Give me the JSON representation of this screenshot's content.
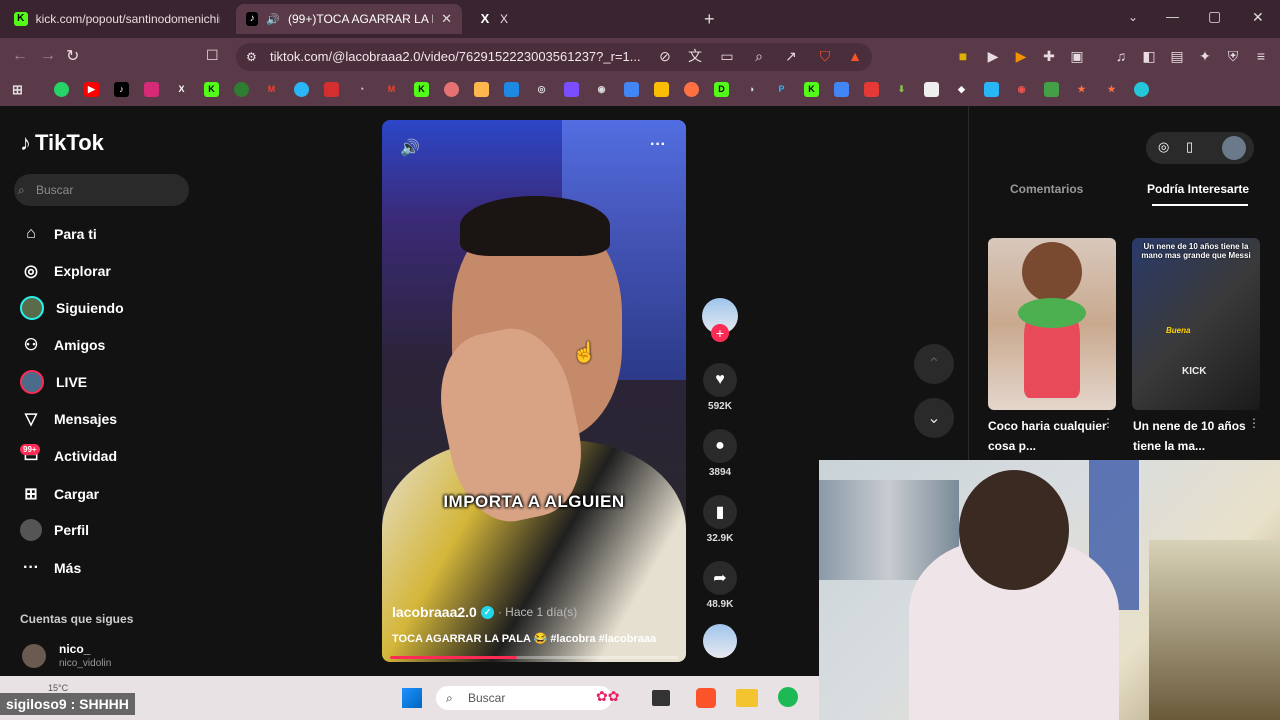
{
  "browser": {
    "tabs": [
      {
        "title": "kick.com/popout/santinodomenichin",
        "favicon": "K",
        "color": "#53fc18"
      },
      {
        "title": "(99+)TOCA AGARRAR LA PAL",
        "favicon": "♪",
        "color": "#000000"
      },
      {
        "title": "X",
        "favicon": "X",
        "color": "#000000"
      }
    ],
    "new_tab": "+",
    "url": "tiktok.com/@lacobraaa2.0/video/7629152223003561237?_r=1...",
    "window_controls": [
      "—",
      "▢",
      "✕"
    ]
  },
  "tiktok": {
    "logo": "TikTok",
    "search_placeholder": "Buscar",
    "nav": [
      {
        "label": "Para ti",
        "icon": "home-icon"
      },
      {
        "label": "Explorar",
        "icon": "compass-icon"
      },
      {
        "label": "Siguiendo",
        "icon": "following-avatar-icon"
      },
      {
        "label": "Amigos",
        "icon": "friends-icon"
      },
      {
        "label": "LIVE",
        "icon": "live-icon"
      },
      {
        "label": "Mensajes",
        "icon": "messages-icon"
      },
      {
        "label": "Actividad",
        "icon": "activity-icon"
      },
      {
        "label": "Cargar",
        "icon": "upload-icon"
      },
      {
        "label": "Perfil",
        "icon": "profile-icon"
      },
      {
        "label": "Más",
        "icon": "more-icon"
      }
    ],
    "activity_badge": "99+",
    "following_header": "Cuentas que sigues",
    "following": [
      {
        "name": "nico_",
        "handle": "nico_vidolin"
      }
    ],
    "weather": "15°C"
  },
  "video": {
    "overlay_text": "IMPORTA A ALGUIEN",
    "username": "lacobraaa2.0",
    "time": "· Hace 1 día(s)",
    "description": "TOCA AGARRAR LA PALA 😂 #lacobra #lacobraaa",
    "progress_percent": 44,
    "likes": "592K",
    "comments": "3894",
    "saves": "32.9K",
    "shares": "48.9K"
  },
  "right_panel": {
    "tabs": [
      "Comentarios",
      "Podría Interesarte"
    ],
    "active_tab": "Podría Interesarte",
    "recommendations": [
      {
        "title": "Coco haria cualquier cosa p..."
      },
      {
        "title": "Un nene de 10 años tiene la ma...",
        "thumb_text": "Un nene de 10 años tiene la mano mas grande que Messi",
        "tag1": "Buena",
        "tag2": "KICK"
      }
    ]
  },
  "stream": {
    "chat_message": "sigiloso9 : SHHHH",
    "taskbar_search": "Buscar"
  }
}
